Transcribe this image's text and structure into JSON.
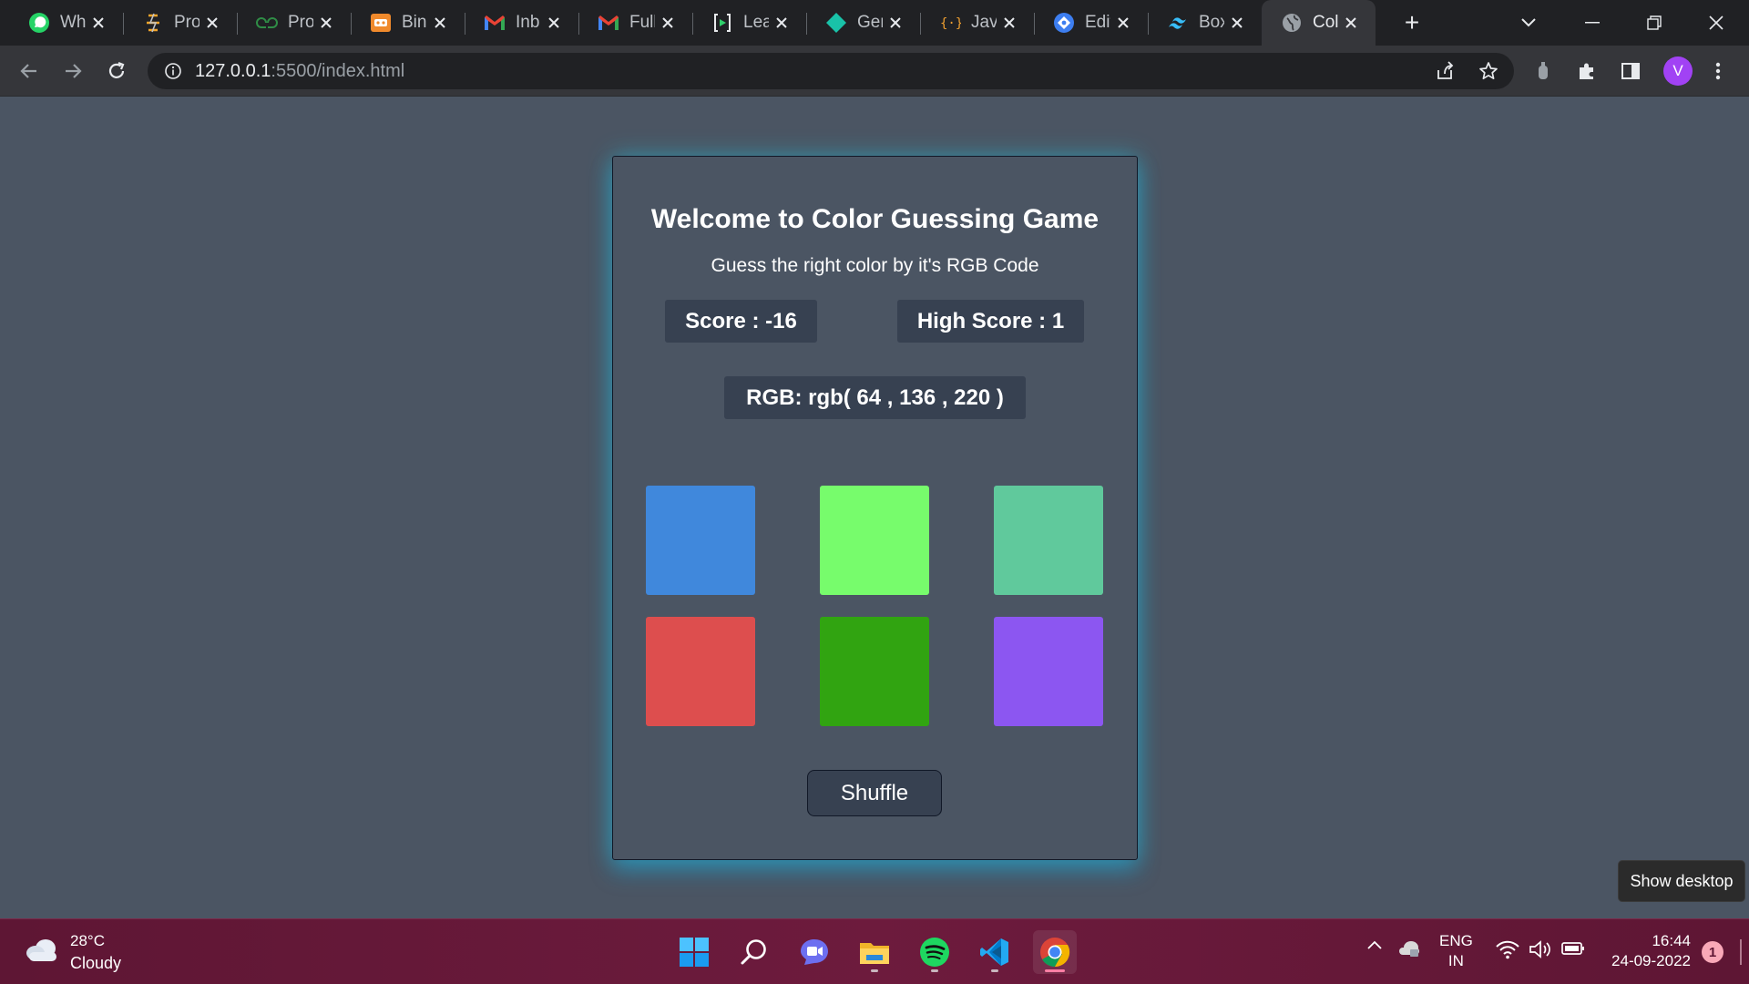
{
  "browser": {
    "tabs": [
      {
        "title": "Wh",
        "icon": "whatsapp-icon",
        "active": false
      },
      {
        "title": "Pro",
        "icon": "project-icon",
        "active": false
      },
      {
        "title": "Pro",
        "icon": "geeksforgeeks-icon",
        "active": false
      },
      {
        "title": "Bin",
        "icon": "coding-site-icon",
        "active": false
      },
      {
        "title": "Inb",
        "icon": "gmail-icon",
        "active": false
      },
      {
        "title": "Full",
        "icon": "gmail-icon",
        "active": false
      },
      {
        "title": "Lea",
        "icon": "learning-icon",
        "active": false
      },
      {
        "title": "Ger",
        "icon": "diamond-icon",
        "active": false
      },
      {
        "title": "Java",
        "icon": "javascript-icon",
        "active": false
      },
      {
        "title": "Edit",
        "icon": "editor-icon",
        "active": false
      },
      {
        "title": "Box",
        "icon": "tailwind-icon",
        "active": false
      },
      {
        "title": "Col",
        "icon": "globe-icon",
        "active": true
      }
    ],
    "url_host": "127.0.0.1",
    "url_rest": ":5500/index.html",
    "profile_initial": "V",
    "accent_color": "#a142f4"
  },
  "game": {
    "title": "Welcome to Color Guessing Game",
    "subtitle": "Guess the right color by it's RGB Code",
    "score_label": "Score : -16",
    "high_score_label": "High Score : 1",
    "rgb_label": "RGB: rgb( 64 , 136 , 220 )",
    "swatches": [
      {
        "color": "#4088dc"
      },
      {
        "color": "#77fc6c"
      },
      {
        "color": "#60c99c"
      },
      {
        "color": "#dd4e4e"
      },
      {
        "color": "#31a411"
      },
      {
        "color": "#8c56f1"
      }
    ],
    "shuffle_label": "Shuffle"
  },
  "tooltip": "Show desktop",
  "taskbar": {
    "weather_temp": "28°C",
    "weather_condition": "Cloudy",
    "apps": [
      "windows-start-icon",
      "search-icon",
      "teams-chat-icon",
      "file-explorer-icon",
      "spotify-icon",
      "vscode-icon",
      "chrome-icon"
    ],
    "lang_1": "ENG",
    "lang_2": "IN",
    "time": "16:44",
    "date": "24-09-2022",
    "notifications": "1"
  }
}
